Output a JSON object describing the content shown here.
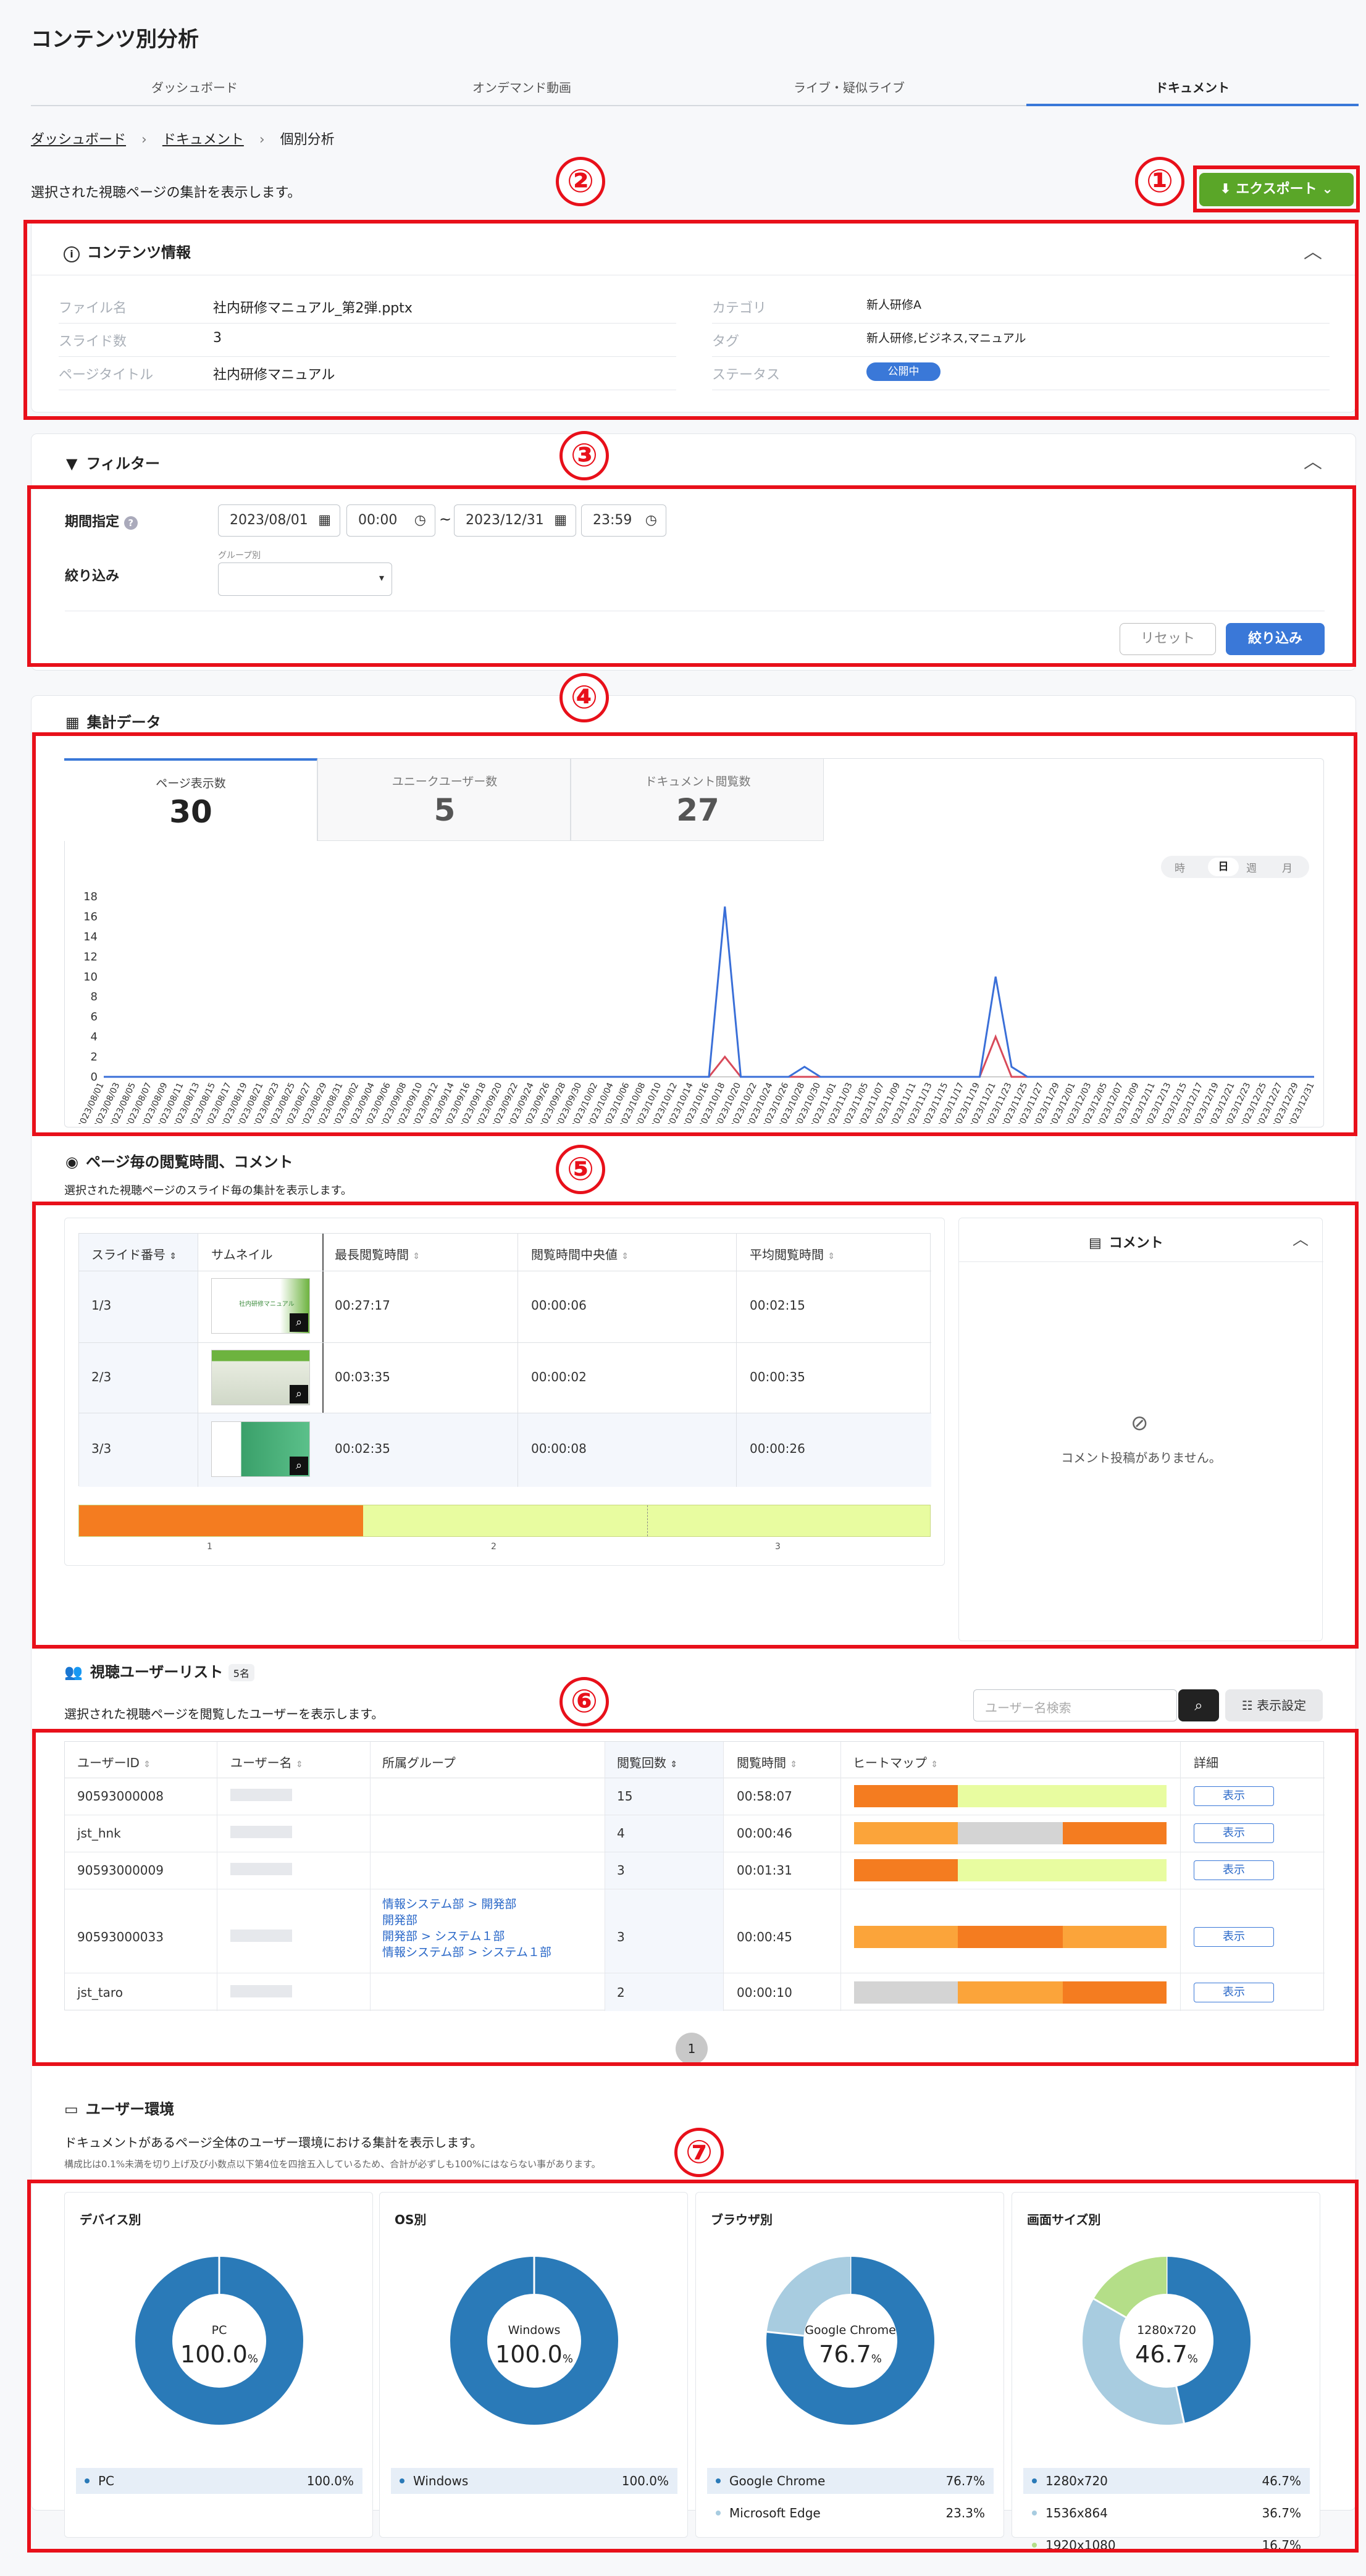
{
  "page_title": "コンテンツ別分析",
  "nav_tabs": [
    {
      "label": "ダッシュボード"
    },
    {
      "label": "オンデマンド動画"
    },
    {
      "label": "ライブ・疑似ライブ"
    },
    {
      "label": "ドキュメント"
    }
  ],
  "breadcrumb": {
    "home": "ダッシュボード",
    "doc": "ドキュメント",
    "current": "個別分析"
  },
  "description": "選択された視聴ページの集計を表示します。",
  "export_label": "エクスポート",
  "callouts": [
    "①",
    "②",
    "③",
    "④",
    "⑤",
    "⑥",
    "⑦"
  ],
  "content_info": {
    "title": "コンテンツ情報",
    "left": [
      {
        "label": "ファイル名",
        "value": "社内研修マニュアル_第2弾.pptx"
      },
      {
        "label": "スライド数",
        "value": "3"
      },
      {
        "label": "ページタイトル",
        "value": "社内研修マニュアル"
      }
    ],
    "right": [
      {
        "label": "カテゴリ",
        "value": "新人研修A"
      },
      {
        "label": "タグ",
        "value": "新人研修,ビジネス,マニュアル"
      },
      {
        "label": "ステータス",
        "value": "公開中"
      }
    ]
  },
  "filter": {
    "title": "フィルター",
    "period_label": "期間指定",
    "start_date": "2023/08/01",
    "start_time": "00:00",
    "tilde": "~",
    "end_date": "2023/12/31",
    "end_time": "23:59",
    "narrow_label": "絞り込み",
    "group_label": "グループ別",
    "reset": "リセット",
    "apply": "絞り込み"
  },
  "summary": {
    "title": "集計データ",
    "metrics": [
      {
        "label": "ページ表示数",
        "value": "30"
      },
      {
        "label": "ユニークユーザー数",
        "value": "5"
      },
      {
        "label": "ドキュメント閲覧数",
        "value": "27"
      }
    ],
    "granularity": [
      "時",
      "日",
      "週",
      "月"
    ]
  },
  "chart_data": {
    "type": "line",
    "title": "",
    "xlabel": "",
    "ylabel": "",
    "ylim": [
      0,
      18
    ],
    "yticks": [
      0,
      2,
      4,
      6,
      8,
      10,
      12,
      14,
      16,
      18
    ],
    "grid": false,
    "legend": "none",
    "x": [
      "2023/08/01",
      "2023/08/03",
      "2023/08/05",
      "2023/08/07",
      "2023/08/09",
      "2023/08/11",
      "2023/08/13",
      "2023/08/15",
      "2023/08/17",
      "2023/08/19",
      "2023/08/21",
      "2023/08/23",
      "2023/08/25",
      "2023/08/27",
      "2023/08/29",
      "2023/08/31",
      "2023/09/02",
      "2023/09/04",
      "2023/09/06",
      "2023/09/08",
      "2023/09/10",
      "2023/09/12",
      "2023/09/14",
      "2023/09/16",
      "2023/09/18",
      "2023/09/20",
      "2023/09/22",
      "2023/09/24",
      "2023/09/26",
      "2023/09/28",
      "2023/09/30",
      "2023/10/02",
      "2023/10/04",
      "2023/10/06",
      "2023/10/08",
      "2023/10/10",
      "2023/10/12",
      "2023/10/14",
      "2023/10/16",
      "2023/10/18",
      "2023/10/20",
      "2023/10/22",
      "2023/10/24",
      "2023/10/26",
      "2023/10/28",
      "2023/10/30",
      "2023/11/01",
      "2023/11/03",
      "2023/11/05",
      "2023/11/07",
      "2023/11/09",
      "2023/11/11",
      "2023/11/13",
      "2023/11/15",
      "2023/11/17",
      "2023/11/19",
      "2023/11/21",
      "2023/11/23",
      "2023/11/25",
      "2023/11/27",
      "2023/11/29",
      "2023/12/01",
      "2023/12/03",
      "2023/12/05",
      "2023/12/07",
      "2023/12/09",
      "2023/12/11",
      "2023/12/13",
      "2023/12/15",
      "2023/12/17",
      "2023/12/19",
      "2023/12/21",
      "2023/12/23",
      "2023/12/25",
      "2023/12/27",
      "2023/12/29",
      "2023/12/31"
    ],
    "series": [
      {
        "color": "#3a6fd8",
        "values": [
          0,
          0,
          0,
          0,
          0,
          0,
          0,
          0,
          0,
          0,
          0,
          0,
          0,
          0,
          0,
          0,
          0,
          0,
          0,
          0,
          0,
          0,
          0,
          0,
          0,
          0,
          0,
          0,
          0,
          0,
          0,
          0,
          0,
          0,
          0,
          0,
          0,
          0,
          0,
          17,
          0,
          0,
          0,
          0,
          1,
          0,
          0,
          0,
          0,
          0,
          0,
          0,
          0,
          0,
          0,
          0,
          10,
          1,
          0,
          0,
          0,
          0,
          0,
          0,
          0,
          0,
          0,
          0,
          0,
          0,
          0,
          0,
          0,
          0,
          0,
          0,
          0
        ]
      },
      {
        "color": "#d84a5a",
        "values": [
          0,
          0,
          0,
          0,
          0,
          0,
          0,
          0,
          0,
          0,
          0,
          0,
          0,
          0,
          0,
          0,
          0,
          0,
          0,
          0,
          0,
          0,
          0,
          0,
          0,
          0,
          0,
          0,
          0,
          0,
          0,
          0,
          0,
          0,
          0,
          0,
          0,
          0,
          0,
          2,
          0,
          0,
          0,
          0,
          0,
          0,
          0,
          0,
          0,
          0,
          0,
          0,
          0,
          0,
          0,
          0,
          4,
          0,
          0,
          0,
          0,
          0,
          0,
          0,
          0,
          0,
          0,
          0,
          0,
          0,
          0,
          0,
          0,
          0,
          0,
          0,
          0
        ]
      }
    ]
  },
  "pages": {
    "title": "ページ毎の閲覧時間、コメント",
    "description": "選択された視聴ページのスライド毎の集計を表示します。",
    "headers": [
      "スライド番号",
      "サムネイル",
      "最長閲覧時間",
      "閲覧時間中央値",
      "平均閲覧時間"
    ],
    "thumb_text": "社内研修マニュアル",
    "rows": [
      {
        "slide": "1/3",
        "max": "00:27:17",
        "median": "00:00:06",
        "avg": "00:02:15"
      },
      {
        "slide": "2/3",
        "max": "00:03:35",
        "median": "00:00:02",
        "avg": "00:00:35"
      },
      {
        "slide": "3/3",
        "max": "00:02:35",
        "median": "00:00:08",
        "avg": "00:00:26"
      }
    ],
    "heat_labels": [
      "1",
      "2",
      "3"
    ],
    "comment_title": "コメント",
    "no_comment": "コメント投稿がありません。"
  },
  "users": {
    "title": "視聴ユーザーリスト",
    "count": "5名",
    "description": "選択された視聴ページを閲覧したユーザーを表示します。",
    "search_placeholder": "ユーザー名検索",
    "settings_label": "表示設定",
    "headers": [
      "ユーザーID",
      "ユーザー名",
      "所属グループ",
      "閲覧回数",
      "閲覧時間",
      "ヒートマップ",
      "詳細"
    ],
    "detail_label": "表示",
    "rows": [
      {
        "id": "90593000008",
        "groups": [],
        "count": "15",
        "time": "00:58:07"
      },
      {
        "id": "jst_hnk",
        "groups": [],
        "count": "4",
        "time": "00:00:46"
      },
      {
        "id": "90593000009",
        "groups": [],
        "count": "3",
        "time": "00:01:31"
      },
      {
        "id": "90593000033",
        "groups": [
          "情報システム部 > 開発部",
          "開発部",
          "開発部 > システム１部",
          "情報システム部 > システム１部"
        ],
        "count": "3",
        "time": "00:00:45"
      },
      {
        "id": "jst_taro",
        "groups": [],
        "count": "2",
        "time": "00:00:10"
      }
    ],
    "page_number": "1"
  },
  "env": {
    "title": "ユーザー環境",
    "description": "ドキュメントがあるページ全体のユーザー環境における集計を表示します。",
    "note": "構成比は0.1%未満を切り上げ及び小数点以下第4位を四捨五入しているため、合計が必ずしも100%にはならない事があります。",
    "charts": [
      {
        "title": "デバイス別",
        "center_label": "PC",
        "center_value": "100.0",
        "items": [
          {
            "name": "PC",
            "value": 100.0,
            "display": "100.0%",
            "color": "#2a7ab8"
          }
        ]
      },
      {
        "title": "OS別",
        "center_label": "Windows",
        "center_value": "100.0",
        "items": [
          {
            "name": "Windows",
            "value": 100.0,
            "display": "100.0%",
            "color": "#2a7ab8"
          }
        ]
      },
      {
        "title": "ブラウザ別",
        "center_label": "Google Chrome",
        "center_value": "76.7",
        "items": [
          {
            "name": "Google Chrome",
            "value": 76.7,
            "display": "76.7%",
            "color": "#2a7ab8"
          },
          {
            "name": "Microsoft Edge",
            "value": 23.3,
            "display": "23.3%",
            "color": "#a8cce0"
          }
        ]
      },
      {
        "title": "画面サイズ別",
        "center_label": "1280x720",
        "center_value": "46.7",
        "items": [
          {
            "name": "1280x720",
            "value": 46.7,
            "display": "46.7%",
            "color": "#2a7ab8"
          },
          {
            "name": "1536x864",
            "value": 36.7,
            "display": "36.7%",
            "color": "#a8cce0"
          },
          {
            "name": "1920x1080",
            "value": 16.7,
            "display": "16.7%",
            "color": "#b4de88"
          }
        ]
      }
    ],
    "percent_sign": "%"
  },
  "colors": {
    "accent": "#3a78d8",
    "export": "#5aa628",
    "heat_dark": "#f47c20",
    "heat_mid": "#fba43a",
    "heat_light": "#e8fca0",
    "heat_gray": "#d4d4d4"
  }
}
